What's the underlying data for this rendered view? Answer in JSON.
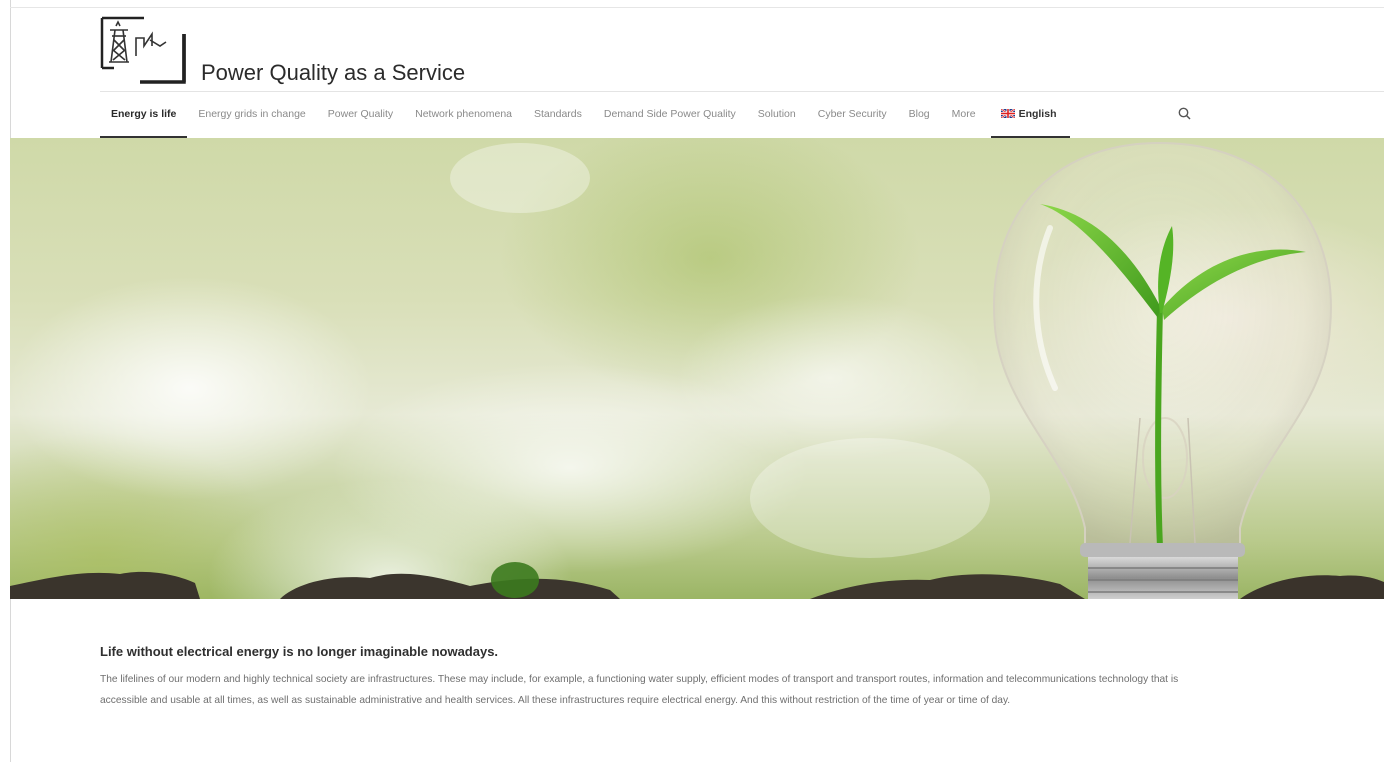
{
  "site": {
    "title": "Power Quality as a Service",
    "logo_icon": "power-pylon-logo-icon"
  },
  "nav": {
    "items": [
      {
        "label": "Energy is life",
        "active": true
      },
      {
        "label": "Energy grids in change",
        "active": false
      },
      {
        "label": "Power Quality",
        "active": false
      },
      {
        "label": "Network phenomena",
        "active": false
      },
      {
        "label": "Standards",
        "active": false
      },
      {
        "label": "Demand Side Power Quality",
        "active": false
      },
      {
        "label": "Solution",
        "active": false
      },
      {
        "label": "Cyber Security",
        "active": false
      },
      {
        "label": "Blog",
        "active": false
      },
      {
        "label": "More",
        "active": false
      }
    ],
    "language": {
      "label": "English",
      "flag": "uk-flag-icon"
    },
    "search_icon": "search-icon"
  },
  "hero": {
    "image": "light-bulb-with-seedling"
  },
  "content": {
    "heading": "Life without electrical energy is no longer imaginable nowadays.",
    "paragraph": "The lifelines of our modern and highly technical society are infrastructures. These may include, for example, a functioning water supply, efficient modes of transport and transport routes, information and telecommunications technology that is accessible and usable at all times, as well as sustainable administrative and health services. All these infrastructures require electrical energy. And this without restriction of the time of year or time of day."
  },
  "colors": {
    "text_dark": "#2a2a2a",
    "text_muted": "#8a8a8a",
    "leaf_green": "#5fb82a",
    "soil": "#3a342c"
  }
}
